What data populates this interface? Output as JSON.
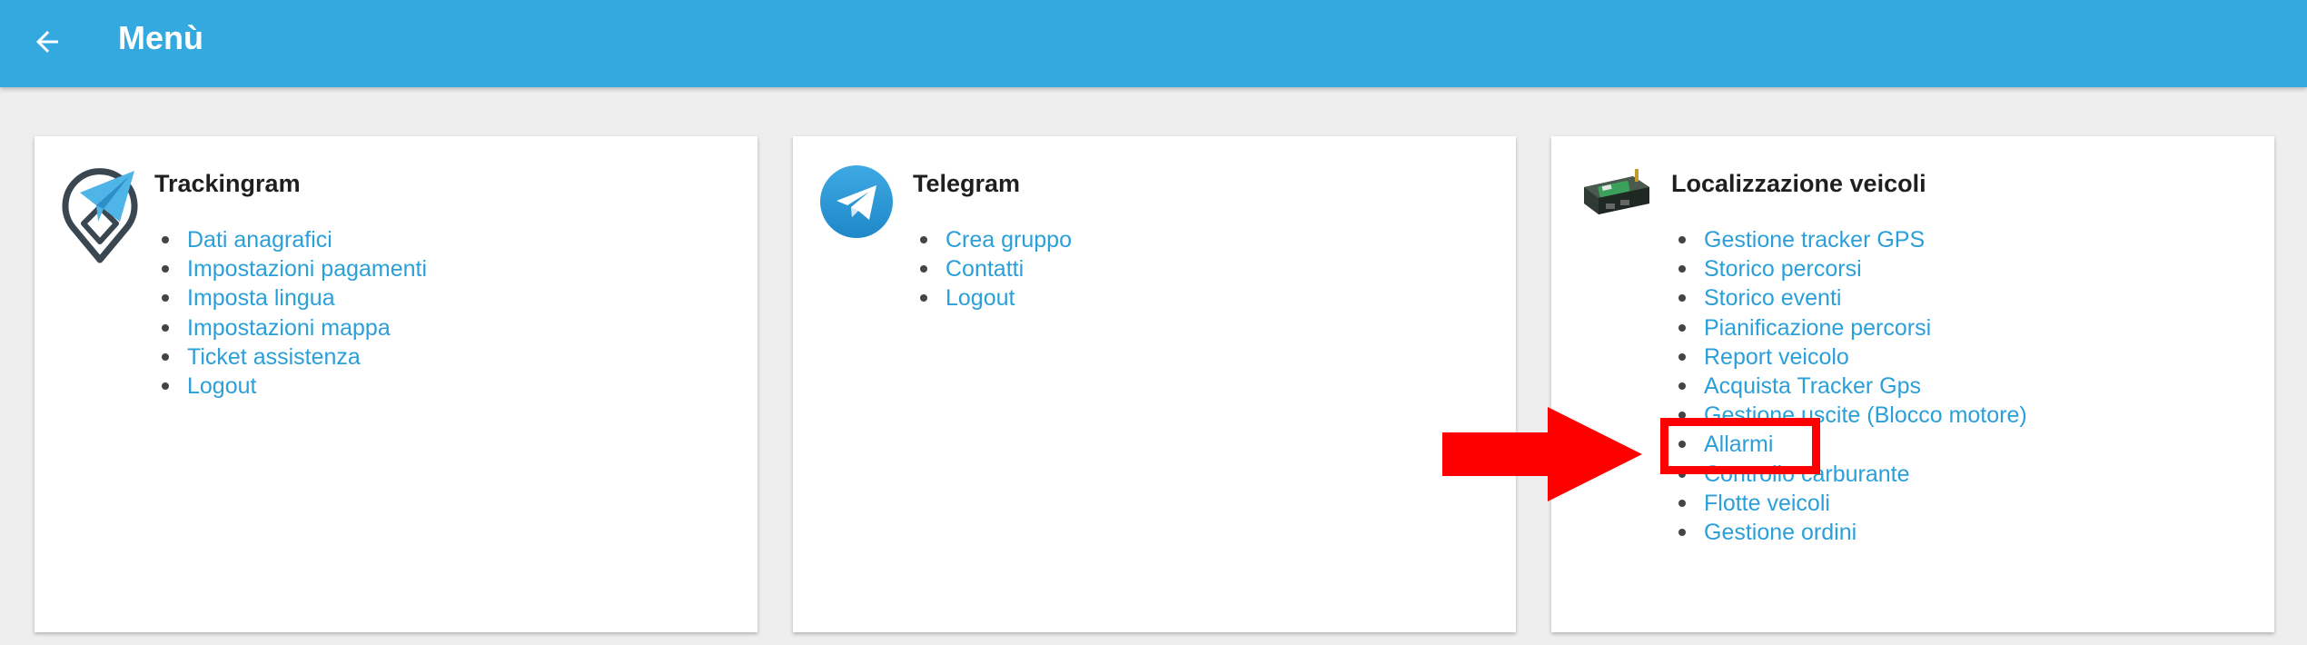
{
  "header": {
    "title": "Menù",
    "back_icon": "arrow-left-icon"
  },
  "colors": {
    "header_bg": "#33a9e0",
    "link": "#2b9fd8",
    "annotation": "#ff0000"
  },
  "cards": [
    {
      "title": "Trackingram",
      "icon": "trackingram-logo-icon",
      "items": [
        "Dati anagrafici",
        "Impostazioni pagamenti",
        "Imposta lingua",
        "Impostazioni mappa",
        "Ticket assistenza",
        "Logout"
      ]
    },
    {
      "title": "Telegram",
      "icon": "telegram-logo-icon",
      "items": [
        "Crea gruppo",
        "Contatti",
        "Logout"
      ]
    },
    {
      "title": "Localizzazione veicoli",
      "icon": "gps-tracker-device-icon",
      "items": [
        "Gestione tracker GPS",
        "Storico percorsi",
        "Storico eventi",
        "Pianificazione percorsi",
        "Report veicolo",
        "Acquista Tracker Gps",
        "Gestione uscite (Blocco motore)",
        "Allarmi",
        "Controllo carburante",
        "Flotte veicoli",
        "Gestione ordini"
      ]
    }
  ],
  "annotation": {
    "highlighted_item": "Allarmi",
    "arrow_icon": "red-arrow-icon"
  }
}
